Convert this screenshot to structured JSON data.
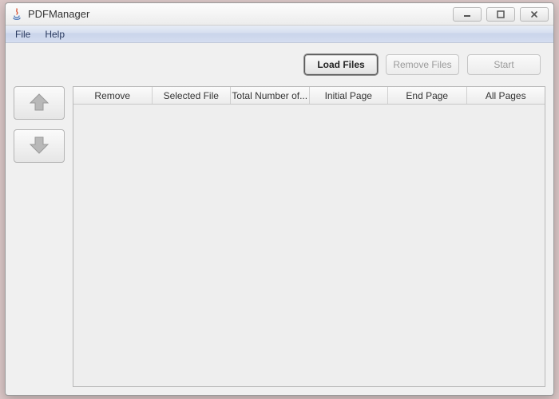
{
  "window": {
    "title": "PDFManager"
  },
  "menu": {
    "file": "File",
    "help": "Help"
  },
  "actions": {
    "load": "Load Files",
    "remove": "Remove Files",
    "start": "Start"
  },
  "table": {
    "columns": [
      "Remove",
      "Selected File",
      "Total Number of...",
      "Initial Page",
      "End Page",
      "All Pages"
    ],
    "rows": []
  }
}
